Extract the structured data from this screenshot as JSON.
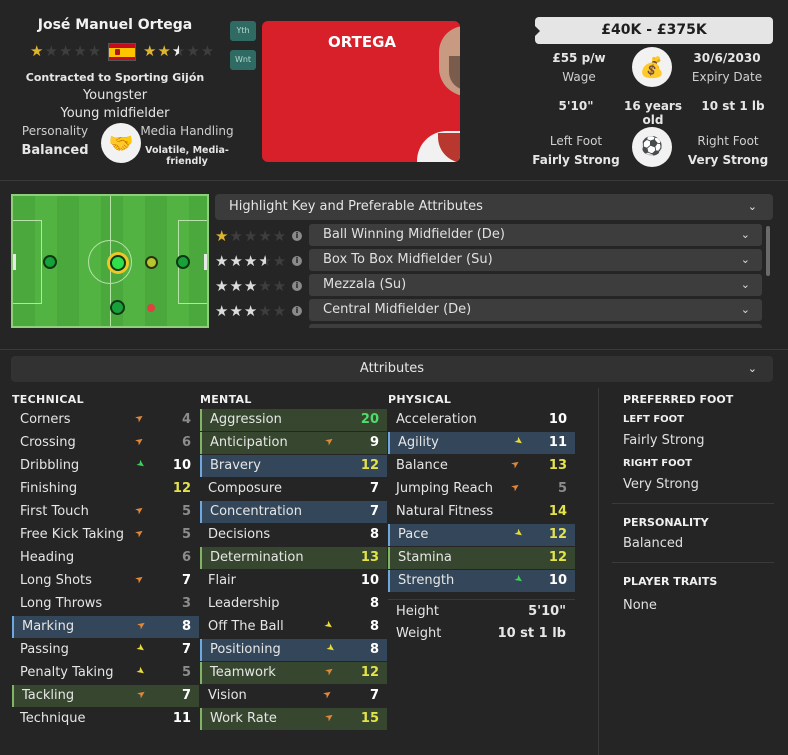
{
  "header": {
    "name": "José Manuel Ortega",
    "contract": "Contracted to Sporting Gijón",
    "status": "Youngster",
    "position": "Young midfielder",
    "personality_label": "Personality",
    "personality_value": "Balanced",
    "media_label": "Media Handling",
    "media_value": "Volatile, Media-friendly",
    "tag_youth": "Yth",
    "tag_wanted": "Wnt",
    "portrait_name": "ORTEGA",
    "value_range": "£40K - £375K",
    "wage_value": "£55 p/w",
    "wage_label": "Wage",
    "expiry_value": "30/6/2030",
    "expiry_label": "Expiry Date",
    "height": "5'10\"",
    "age": "16 years old",
    "weight": "10 st 1 lb",
    "left_foot_label": "Left Foot",
    "left_foot_value": "Fairly Strong",
    "right_foot_label": "Right Foot",
    "right_foot_value": "Very Strong",
    "current_stars": 1,
    "potential_stars": 2.5,
    "colors": {
      "accent_red": "#d8202a",
      "star": "#e0b52e",
      "teal": "#2f6b63"
    }
  },
  "roles": {
    "highlight_label": "Highlight Key and Preferable Attributes",
    "items": [
      {
        "label": "Ball Winning Midfielder (De)",
        "stars": 1
      },
      {
        "label": "Box To Box Midfielder (Su)",
        "stars": 3.5
      },
      {
        "label": "Mezzala (Su)",
        "stars": 3
      },
      {
        "label": "Central Midfielder (De)",
        "stars": 3
      }
    ]
  },
  "attributes": {
    "title": "Attributes",
    "technical_title": "TECHNICAL",
    "mental_title": "MENTAL",
    "physical_title": "PHYSICAL",
    "technical": [
      {
        "name": "Corners",
        "value": "4"
      },
      {
        "name": "Crossing",
        "value": "6"
      },
      {
        "name": "Dribbling",
        "value": "10"
      },
      {
        "name": "Finishing",
        "value": "12"
      },
      {
        "name": "First Touch",
        "value": "5"
      },
      {
        "name": "Free Kick Taking",
        "value": "5"
      },
      {
        "name": "Heading",
        "value": "6"
      },
      {
        "name": "Long Shots",
        "value": "7"
      },
      {
        "name": "Long Throws",
        "value": "3"
      },
      {
        "name": "Marking",
        "value": "8"
      },
      {
        "name": "Passing",
        "value": "7"
      },
      {
        "name": "Penalty Taking",
        "value": "5"
      },
      {
        "name": "Tackling",
        "value": "7"
      },
      {
        "name": "Technique",
        "value": "11"
      }
    ],
    "mental": [
      {
        "name": "Aggression",
        "value": "20"
      },
      {
        "name": "Anticipation",
        "value": "9"
      },
      {
        "name": "Bravery",
        "value": "12"
      },
      {
        "name": "Composure",
        "value": "7"
      },
      {
        "name": "Concentration",
        "value": "7"
      },
      {
        "name": "Decisions",
        "value": "8"
      },
      {
        "name": "Determination",
        "value": "13"
      },
      {
        "name": "Flair",
        "value": "10"
      },
      {
        "name": "Leadership",
        "value": "8"
      },
      {
        "name": "Off The Ball",
        "value": "8"
      },
      {
        "name": "Positioning",
        "value": "8"
      },
      {
        "name": "Teamwork",
        "value": "12"
      },
      {
        "name": "Vision",
        "value": "7"
      },
      {
        "name": "Work Rate",
        "value": "15"
      }
    ],
    "physical": [
      {
        "name": "Acceleration",
        "value": "10"
      },
      {
        "name": "Agility",
        "value": "11"
      },
      {
        "name": "Balance",
        "value": "13"
      },
      {
        "name": "Jumping Reach",
        "value": "5"
      },
      {
        "name": "Natural Fitness",
        "value": "14"
      },
      {
        "name": "Pace",
        "value": "12"
      },
      {
        "name": "Stamina",
        "value": "12"
      },
      {
        "name": "Strength",
        "value": "10"
      }
    ],
    "height_label": "Height",
    "height_value": "5'10\"",
    "weight_label": "Weight",
    "weight_value": "10 st 1 lb"
  },
  "side": {
    "preferred_foot_title": "PREFERRED FOOT",
    "left_foot_title": "LEFT FOOT",
    "left_foot_value": "Fairly Strong",
    "right_foot_title": "RIGHT FOOT",
    "right_foot_value": "Very Strong",
    "personality_title": "PERSONALITY",
    "personality_value": "Balanced",
    "traits_title": "PLAYER TRAITS",
    "traits_value": "None"
  }
}
